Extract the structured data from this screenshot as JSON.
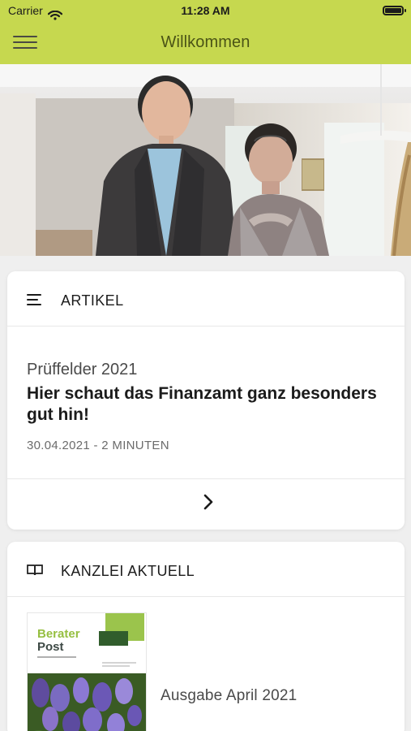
{
  "status_bar": {
    "carrier": "Carrier",
    "time": "11:28 AM"
  },
  "nav": {
    "title": "Willkommen",
    "menu_icon": "hamburger-menu-icon"
  },
  "theme": {
    "accent": "#c6d84f",
    "nav_title_color": "#4b5416",
    "background": "#efefef"
  },
  "sections": {
    "artikel": {
      "title": "ARTIKEL",
      "icon": "list-icon",
      "article": {
        "kicker": "Prüffelder 2021",
        "headline": "Hier schaut das Finanzamt ganz besonders gut hin!",
        "meta": "30.04.2021 - 2 MINUTEN"
      },
      "next_icon": "chevron-right-icon"
    },
    "kanzlei": {
      "title": "KANZLEI AKTUELL",
      "icon": "book-icon",
      "issue": {
        "title": "Ausgabe April 2021",
        "cover_brand": "Berater\nPost"
      }
    }
  }
}
